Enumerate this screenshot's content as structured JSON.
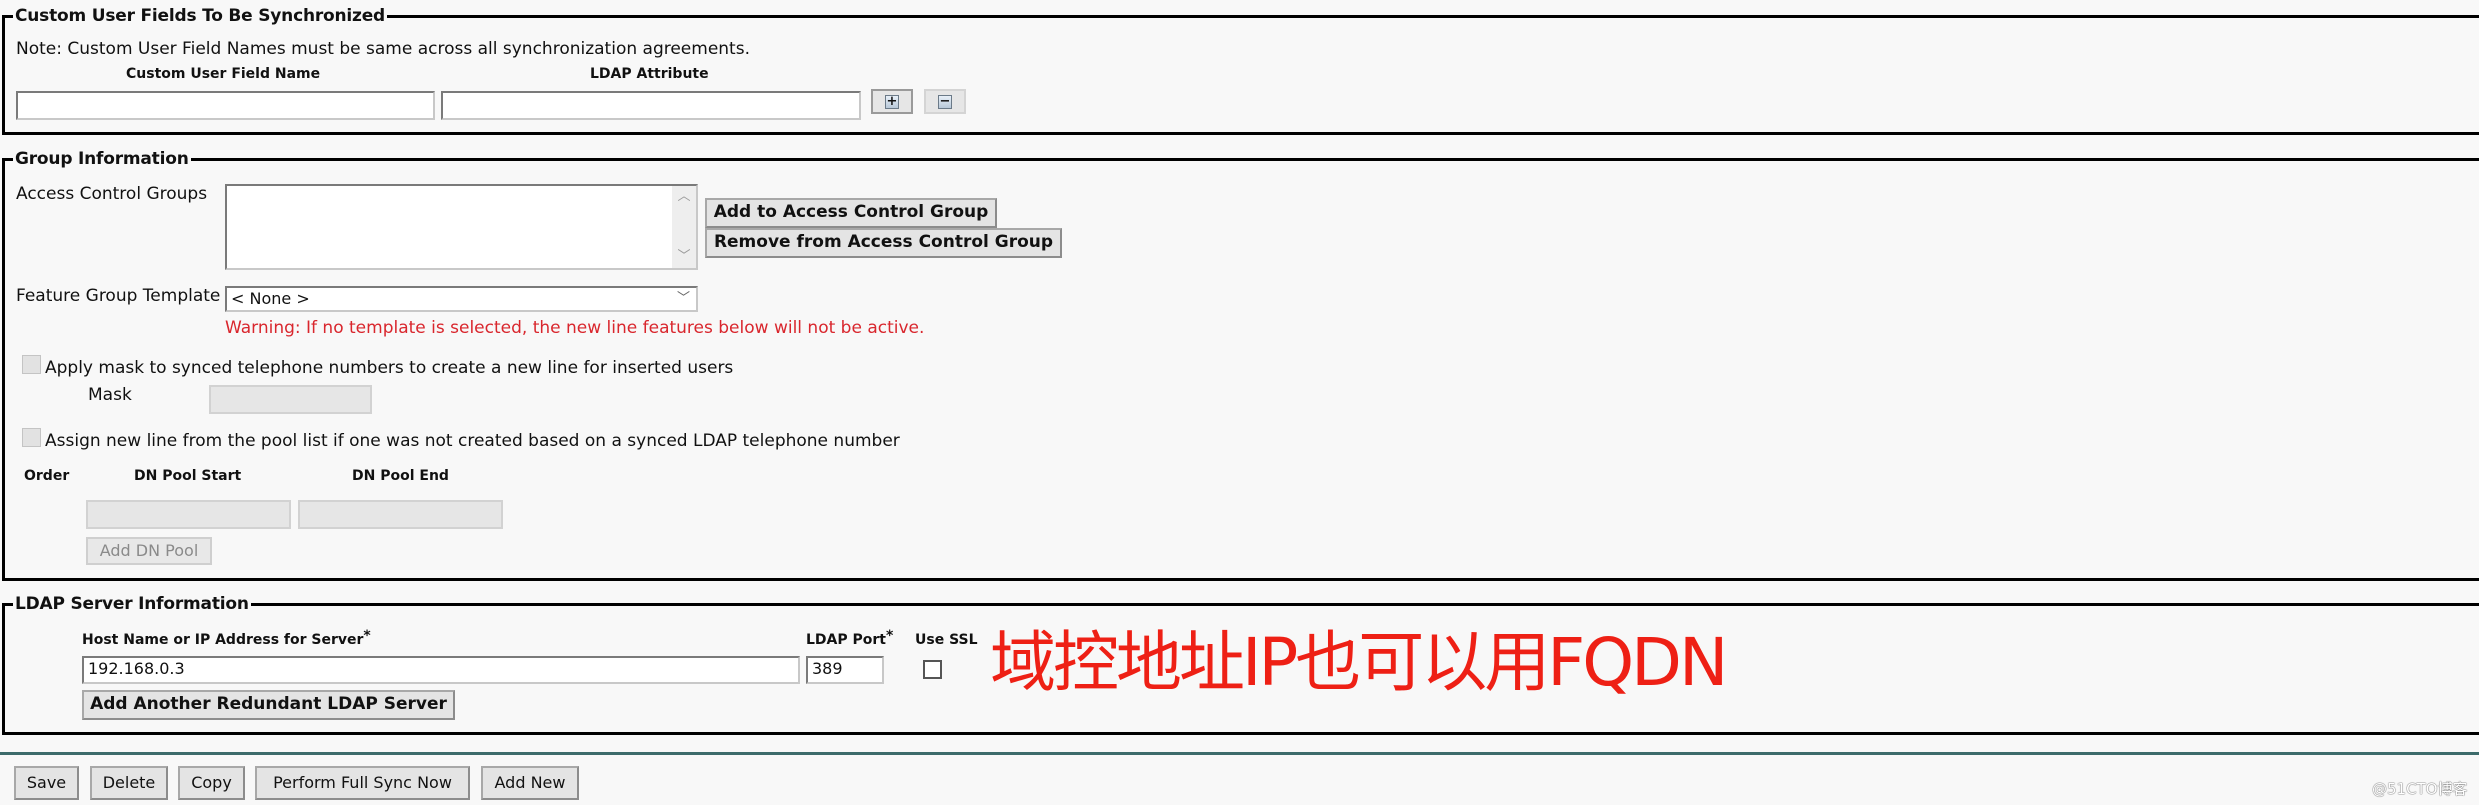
{
  "custom_fields": {
    "legend": "Custom User Fields To Be Synchronized",
    "note": "Note: Custom User Field Names must be same across all synchronization agreements.",
    "col_name_header": "Custom User Field Name",
    "col_attr_header": "LDAP Attribute",
    "field_name_value": "",
    "ldap_attribute_value": "",
    "add_icon": "plus-icon",
    "remove_icon": "minus-icon"
  },
  "group_info": {
    "legend": "Group Information",
    "access_control_groups_label": "Access Control Groups",
    "access_control_groups_items": [],
    "add_button": "Add to Access Control Group",
    "remove_button": "Remove from Access Control Group",
    "feature_group_template_label": "Feature Group Template",
    "feature_group_template_value": "< None >",
    "warning": "Warning: If no template is selected, the new line features below will not be active.",
    "apply_mask_label": "Apply mask to synced telephone numbers to create a new line for inserted users",
    "apply_mask_checked": false,
    "mask_label": "Mask",
    "mask_value": "",
    "assign_pool_label": "Assign new line from the pool list if one was not created based on a synced LDAP telephone number",
    "assign_pool_checked": false,
    "pool_headers": {
      "order": "Order",
      "start": "DN Pool Start",
      "end": "DN Pool End"
    },
    "pool_start_value": "",
    "pool_end_value": "",
    "add_dn_pool_button": "Add DN Pool"
  },
  "ldap_server": {
    "legend": "LDAP Server Information",
    "host_label": "Host Name or IP Address for Server",
    "required_marker": "*",
    "port_label": "LDAP Port",
    "ssl_label": "Use SSL",
    "host_value": "192.168.0.3",
    "port_value": "389",
    "use_ssl": false,
    "add_server_button": "Add Another Redundant LDAP Server"
  },
  "annotation": "域控地址IP也可以用FQDN",
  "actions": {
    "save": "Save",
    "delete": "Delete",
    "copy": "Copy",
    "full_sync": "Perform Full Sync Now",
    "add_new": "Add New"
  },
  "watermark": "@51CTO博客",
  "colors": {
    "warning": "#d9262d",
    "annotation": "#ee2015",
    "divider": "#3d6b6b"
  }
}
